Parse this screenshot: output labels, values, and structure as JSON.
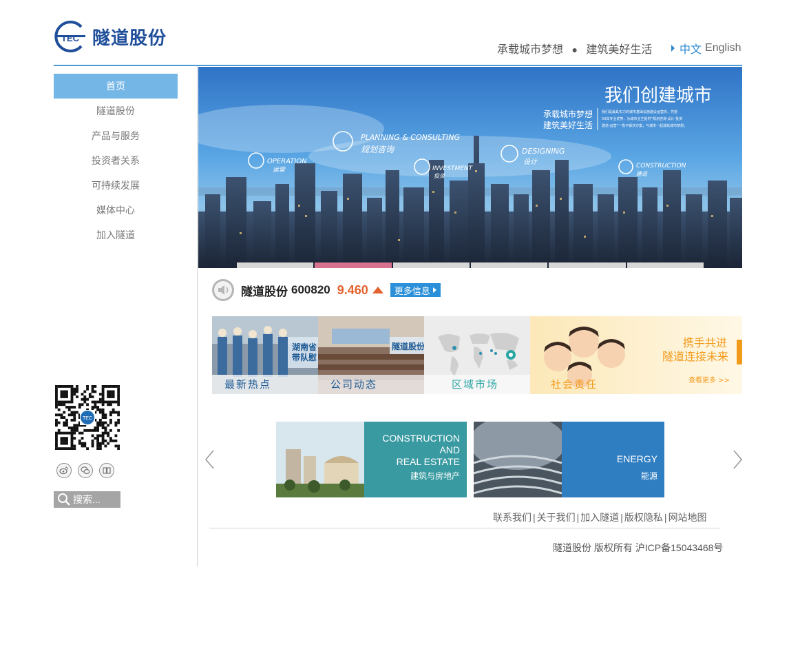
{
  "header": {
    "logo_abbr": "TEC",
    "logo_text": "隧道股份",
    "slogan_part1": "承载城市梦想",
    "slogan_part2": "建筑美好生活",
    "lang_zh": "中文",
    "lang_en": "English"
  },
  "nav": {
    "items": [
      {
        "label": "首页",
        "active": true
      },
      {
        "label": "隧道股份"
      },
      {
        "label": "产品与服务"
      },
      {
        "label": "投资者关系"
      },
      {
        "label": "可持续发展"
      },
      {
        "label": "媒体中心"
      },
      {
        "label": "加入隧道"
      }
    ]
  },
  "search": {
    "placeholder": "搜索..."
  },
  "social": {
    "icons": [
      "weibo-icon",
      "wechat-icon",
      "book-icon"
    ]
  },
  "banner": {
    "headline": "我们创建城市",
    "sub1": "承载城市梦想",
    "sub2": "建筑美好生活",
    "blurb1": "我们是最具实力的城市基础设施建设运营商，凭借",
    "blurb2": "50年专业优势，为城市业主提供“规划咨询·设计·投资",
    "blurb3": "建造·运营”一揽子解决方案，与城市一起成就城市梦想。",
    "icons": [
      {
        "en": "OPERATION",
        "zh": "运营"
      },
      {
        "en": "PLANNING & CONSULTING",
        "zh": "规划咨询"
      },
      {
        "en": "INVESTMENT",
        "zh": "投资"
      },
      {
        "en": "DESIGNING",
        "zh": "设计"
      },
      {
        "en": "CONSTRUCTION",
        "zh": "建造"
      }
    ],
    "active_slide": 2,
    "slide_count": 6
  },
  "stock": {
    "name": "隧道股份",
    "code": "600820",
    "price": "9.460",
    "more_label": "更多信息"
  },
  "tiles": [
    {
      "label": "最新热点",
      "overlay": "湖南省\n带队慰"
    },
    {
      "label": "公司动态",
      "overlay": "隧道股份"
    },
    {
      "label": "区域市场"
    },
    {
      "label": "社会责任",
      "line1": "携手共进",
      "line2": "隧道连接未来",
      "more": "查看更多 >>"
    }
  ],
  "business": [
    {
      "en": [
        "CONSTRUCTION",
        "AND",
        "REAL ESTATE"
      ],
      "zh": "建筑与房地产",
      "color": "#3b9aa3"
    },
    {
      "en": [
        "ENERGY"
      ],
      "zh": "能源",
      "color": "#2f7fc4"
    }
  ],
  "footer": {
    "links": [
      "联系我们",
      "关于我们",
      "加入隧道",
      "版权隐私",
      "网站地图"
    ],
    "copyright": "隧道股份 版权所有 沪ICP备15043468号"
  }
}
